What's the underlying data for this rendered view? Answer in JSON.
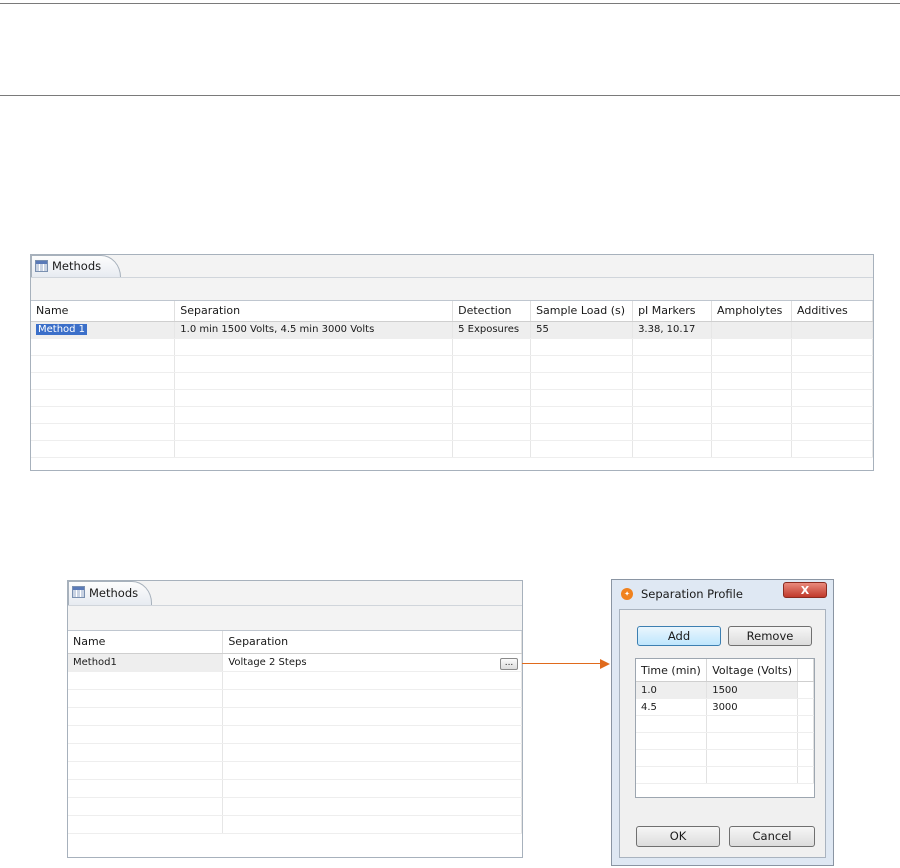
{
  "top_view": {
    "tab_label": "Methods",
    "columns": [
      "Name",
      "Separation",
      "Detection",
      "Sample Load (s)",
      "pI Markers",
      "Ampholytes",
      "Additives"
    ],
    "row": {
      "name": "Method 1",
      "separation": "1.0 min 1500 Volts, 4.5 min 3000 Volts",
      "detection": "5 Exposures",
      "sample_load": "55",
      "pi_markers": "3.38, 10.17",
      "ampholytes": "",
      "additives": ""
    }
  },
  "bottom_view": {
    "tab_label": "Methods",
    "columns": [
      "Name",
      "Separation"
    ],
    "row": {
      "name": "Method1",
      "separation": "Voltage 2 Steps",
      "edit_button_label": "..."
    }
  },
  "dialog": {
    "title": "Separation Profile",
    "close_label": "X",
    "add_label": "Add",
    "remove_label": "Remove",
    "columns": [
      "Time (min)",
      "Voltage (Volts)"
    ],
    "rows": [
      {
        "time": "1.0",
        "voltage": "1500"
      },
      {
        "time": "4.5",
        "voltage": "3000"
      }
    ],
    "ok_label": "OK",
    "cancel_label": "Cancel"
  },
  "colors": {
    "arrow": "#e06a1c",
    "selection": "#3b6fc9",
    "close_button": "#c0392b"
  }
}
